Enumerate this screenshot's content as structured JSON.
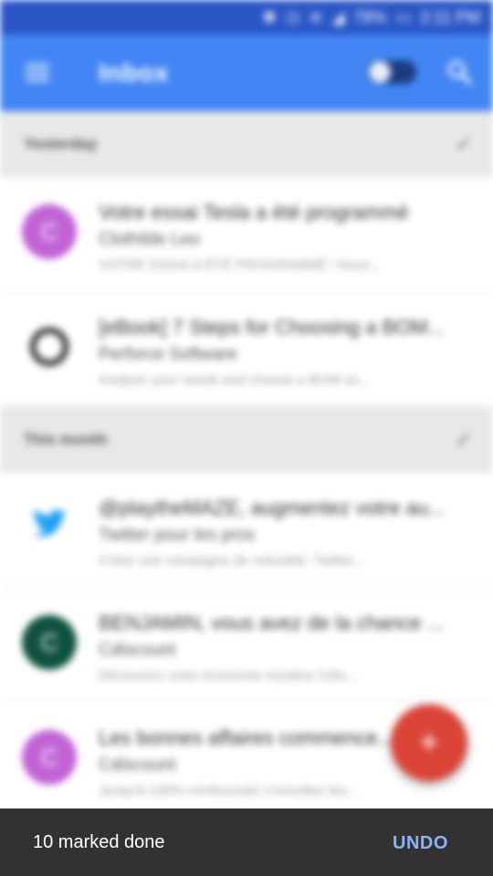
{
  "status_bar": {
    "battery": "78%",
    "time": "2:11 PM"
  },
  "appbar": {
    "title": "Inbox"
  },
  "sections": [
    {
      "label": "Yesterday",
      "emails": [
        {
          "avatar_letter": "C",
          "avatar_color": "#c162d6",
          "subject": "Votre essai Tesla a été programmé",
          "sender": "Clothilde Leo",
          "snippet": "VOTRE ESSAI A ÉTÉ PROGRAMMÉ ! Nous..."
        },
        {
          "avatar_letter": "",
          "avatar_color": "#ffffff",
          "subject": "[eBook] 7 Steps for Choosing a BOM...",
          "sender": "Perforce Software",
          "snippet": "Analyse your needs and choose a BOM so..."
        }
      ]
    },
    {
      "label": "This month",
      "emails": [
        {
          "avatar_letter": "",
          "avatar_color": "#ffffff",
          "subject": "@playtheMAZE, augmentez votre au...",
          "sender": "Twitter pour les pros",
          "snippet": "Créez une campagne de notoriété. Twitter..."
        },
        {
          "avatar_letter": "C",
          "avatar_color": "#0f5240",
          "subject": "BENJAMIN, vous avez de la chance ...",
          "sender": "Cdiscount",
          "snippet": "Découvrez votre économie mystère Cdis..."
        },
        {
          "avatar_letter": "C",
          "avatar_color": "#c162d6",
          "subject": "Les bonnes affaires commence...",
          "sender": "Cdiscount",
          "snippet": "Jusqu'à 100% remboursés Consultez les..."
        }
      ]
    }
  ],
  "fab": {
    "label": "+"
  },
  "snackbar": {
    "message": "10 marked done",
    "action": "UNDO"
  },
  "colors": {
    "status_bar": "#2a56c6",
    "appbar": "#4285f4",
    "fab": "#db4437",
    "snackbar": "#323232",
    "undo": "#8ab4f8",
    "annotation_circle": "#e53935"
  }
}
